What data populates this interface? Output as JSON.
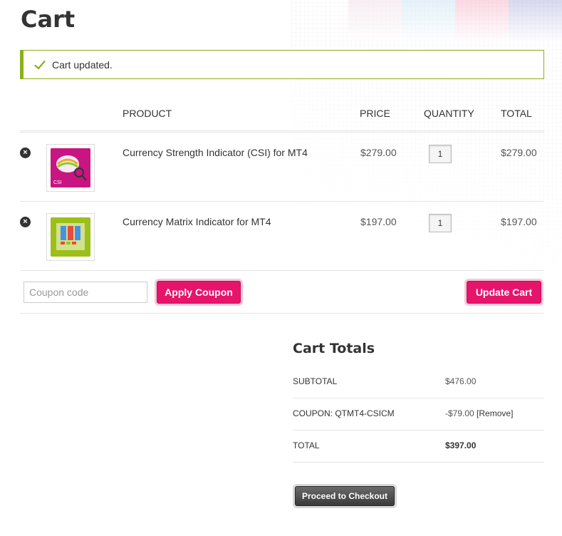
{
  "page": {
    "title": "Cart"
  },
  "notice": {
    "message": "Cart updated.",
    "icon": "check-icon",
    "accent_color": "#8fae1b"
  },
  "table": {
    "headers": {
      "product": "PRODUCT",
      "price": "PRICE",
      "quantity": "QUANTITY",
      "total": "TOTAL"
    },
    "rows": [
      {
        "name": "Currency Strength Indicator (CSI) for MT4",
        "price": "$279.00",
        "quantity": "1",
        "total": "$279.00",
        "thumb_label": "CSI"
      },
      {
        "name": "Currency Matrix Indicator for MT4",
        "price": "$197.00",
        "quantity": "1",
        "total": "$197.00",
        "thumb_label": ""
      }
    ]
  },
  "actions": {
    "coupon_placeholder": "Coupon code",
    "apply_label": "Apply Coupon",
    "update_label": "Update Cart",
    "button_color": "#e6146b"
  },
  "totals": {
    "title": "Cart Totals",
    "subtotal_label": "SUBTOTAL",
    "subtotal_value": "$476.00",
    "coupon_label": "COUPON: QTMT4-CSICM",
    "coupon_value": "-$79.00",
    "coupon_remove": "[Remove]",
    "total_label": "TOTAL",
    "total_value": "$397.00"
  },
  "checkout": {
    "label": "Proceed to Checkout"
  }
}
